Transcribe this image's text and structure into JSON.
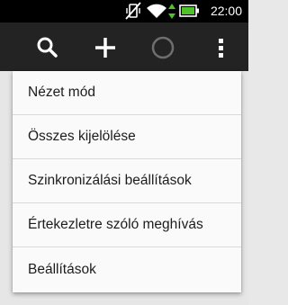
{
  "status_bar": {
    "time": "22:00",
    "icons": [
      "vibrate-off-icon",
      "wifi-icon",
      "data-arrows-icon",
      "battery-icon"
    ],
    "accent_color": "#4fc12a"
  },
  "action_bar": {
    "buttons": [
      "search-icon",
      "add-icon",
      "sync-progress-icon",
      "overflow-menu-icon"
    ]
  },
  "menu": {
    "items": [
      {
        "label": "Nézet mód"
      },
      {
        "label": "Összes kijelölése"
      },
      {
        "label": "Szinkronizálási beállítások"
      },
      {
        "label": "Értekezletre szóló meghívás"
      },
      {
        "label": "Beállítások"
      }
    ]
  }
}
